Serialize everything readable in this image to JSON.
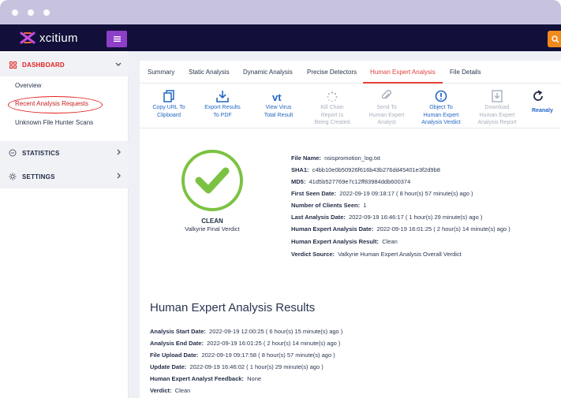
{
  "brand": {
    "name": "xcitium",
    "accent": "#8d3fc7",
    "topbar_color": "#12103a"
  },
  "sidebar": {
    "groups": [
      {
        "label": "DASHBOARD",
        "icon": "dashboard-grid-icon",
        "color": "#e32020"
      },
      {
        "label": "STATISTICS",
        "icon": "statistics-circle-icon"
      },
      {
        "label": "SETTINGS",
        "icon": "settings-gear-icon"
      }
    ],
    "dashboard_items": [
      {
        "label": "Overview"
      },
      {
        "label": "Recent Analysis Requests",
        "highlighted": true
      },
      {
        "label": "Unknown File Hunter Scans"
      }
    ]
  },
  "tabs": [
    {
      "label": "Summary"
    },
    {
      "label": "Static Analysis"
    },
    {
      "label": "Dynamic Analysis"
    },
    {
      "label": "Precise Detectors"
    },
    {
      "label": "Human Expert Analysis",
      "active": true
    },
    {
      "label": "File Details"
    }
  ],
  "toolbar": [
    {
      "line1": "Copy URL To",
      "line2": "Clipboard",
      "icon": "copy-icon",
      "enabled": true
    },
    {
      "line1": "Export Results",
      "line2": "To PDF",
      "icon": "download-icon",
      "enabled": true
    },
    {
      "line1": "View Virus",
      "line2": "Total Result",
      "icon": "virustotal-icon",
      "enabled": true
    },
    {
      "line1": "Kill Chain",
      "line2": "Report Is",
      "line3": "Being Created",
      "icon": "loading-icon",
      "enabled": false
    },
    {
      "line1": "Send To",
      "line2": "Human Expert",
      "line3": "Analyst",
      "icon": "paperclip-icon",
      "enabled": false
    },
    {
      "line1": "Object To",
      "line2": "Human Expert",
      "line3": "Analysis Verdict",
      "icon": "alert-circle-icon",
      "enabled": true
    },
    {
      "line1": "Download",
      "line2": "Human Expert",
      "line3": "Analysis Report",
      "icon": "download-report-icon",
      "enabled": false
    },
    {
      "line1": "Reanaly",
      "icon": "reanalyze-icon",
      "enabled": true
    }
  ],
  "verdict": {
    "status": "CLEAN",
    "subtitle": "Valkyrie Final Verdict",
    "color": "#7cc242"
  },
  "file_info": [
    {
      "label": "File Name:",
      "value": "nsispromotion_log.txt"
    },
    {
      "label": "SHA1:",
      "value": "c4bb10e0b50926f616b43b276dd45401e3f2d9b8"
    },
    {
      "label": "MD5:",
      "value": "41d5b527769e7c12ff83984ddb600374"
    },
    {
      "label": "First Seen Date:",
      "value": "2022-09-19 09:18:17 ( 8 hour(s) 57 minute(s) ago )"
    },
    {
      "label": "Number of Clients Seen:",
      "value": "1"
    },
    {
      "label": "Last Analysis Date:",
      "value": "2022-09-19 16:46:17 ( 1 hour(s) 29 minute(s) ago )"
    },
    {
      "label": "Human Expert Analysis Date:",
      "value": "2022-09-19 16:01:25 ( 2 hour(s) 14 minute(s) ago )"
    },
    {
      "label": "Human Expert Analysis Result:",
      "value": "Clean"
    },
    {
      "label": "Verdict Source:",
      "value": "Valkyrie Human Expert Analysis Overall Verdict"
    }
  ],
  "results": {
    "title": "Human Expert Analysis Results",
    "rows": [
      {
        "label": "Analysis Start Date:",
        "value": "2022-09-19 12:00:25 ( 6 hour(s) 15 minute(s) ago )"
      },
      {
        "label": "Analysis End Date:",
        "value": "2022-09-19 16:01:25 ( 2 hour(s) 14 minute(s) ago )"
      },
      {
        "label": "File Upload Date:",
        "value": "2022-09-19 09:17:58 ( 8 hour(s) 57 minute(s) ago )"
      },
      {
        "label": "Update Date:",
        "value": "2022-09-19 16:46:02 ( 1 hour(s) 29 minute(s) ago )"
      },
      {
        "label": "Human Expert Analyst Feedback:",
        "value": "None"
      },
      {
        "label": "Verdict:",
        "value": "Clean"
      }
    ]
  }
}
